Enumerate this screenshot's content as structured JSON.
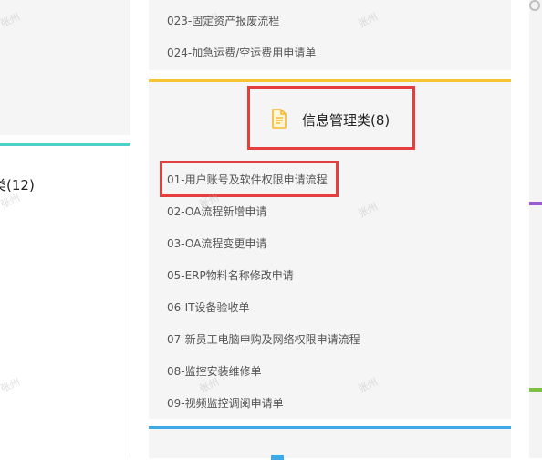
{
  "left_card": {
    "title": "类(12)"
  },
  "top_card": {
    "items": [
      "023-固定资产报废流程",
      "024-加急运费/空运费用申请单"
    ]
  },
  "info_card": {
    "title": "信息管理类(8)",
    "icon": "document-icon",
    "items": [
      "01-用户账号及软件权限申请流程",
      "02-OA流程新增申请",
      "03-OA流程变更申请",
      "05-ERP物料名称修改申请",
      "06-IT设备验收单",
      "07-新员工电脑申购及网络权限申请流程",
      "08-监控安装维修单",
      "09-视频监控调阅申请单"
    ]
  },
  "watermark": "张州",
  "colors": {
    "accent_teal": "#4dd0c8",
    "accent_yellow": "#f7c531",
    "accent_blue": "#3fa9e8",
    "highlight_red": "#e53e3e",
    "accent_purple": "#9b59d6",
    "accent_green": "#7cc142"
  }
}
